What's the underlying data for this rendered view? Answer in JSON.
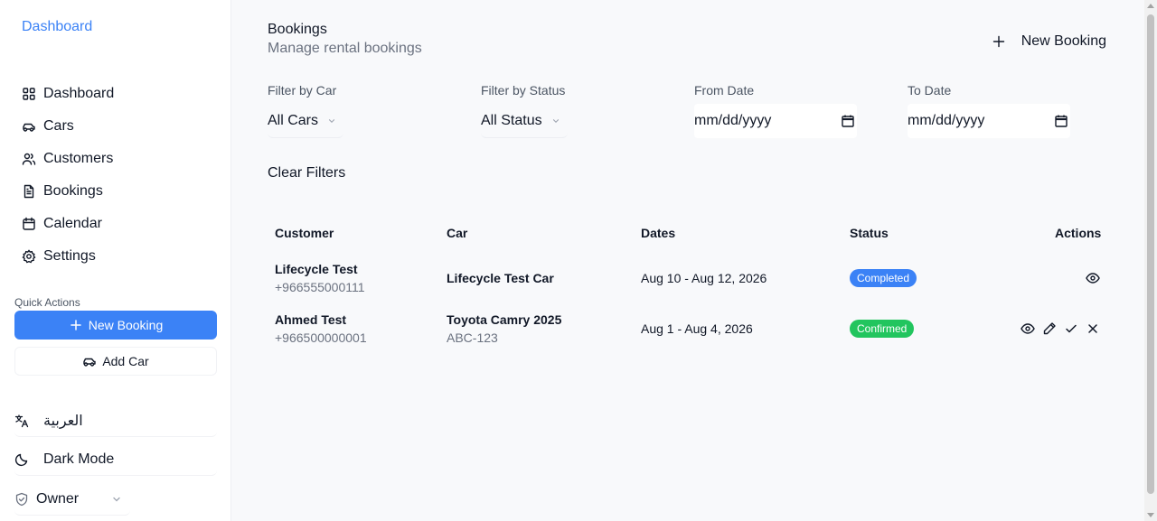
{
  "sidebar": {
    "brand": "Dashboard",
    "nav": [
      {
        "label": "Dashboard",
        "icon": "grid-icon"
      },
      {
        "label": "Cars",
        "icon": "car-icon"
      },
      {
        "label": "Customers",
        "icon": "users-icon"
      },
      {
        "label": "Bookings",
        "icon": "file-text-icon"
      },
      {
        "label": "Calendar",
        "icon": "calendar-icon"
      },
      {
        "label": "Settings",
        "icon": "gear-icon"
      }
    ],
    "quick_actions_label": "Quick Actions",
    "new_booking_label": "New Booking",
    "add_car_label": "Add Car",
    "language_label": "العربية",
    "dark_mode_label": "Dark Mode",
    "role_label": "Owner"
  },
  "header": {
    "title": "Bookings",
    "subtitle": "Manage rental bookings",
    "new_booking_label": "New Booking"
  },
  "filters": {
    "car": {
      "label": "Filter by Car",
      "value": "All Cars"
    },
    "status": {
      "label": "Filter by Status",
      "value": "All Status"
    },
    "from": {
      "label": "From Date",
      "placeholder": "mm/dd/yyyy"
    },
    "to": {
      "label": "To Date",
      "placeholder": "mm/dd/yyyy"
    },
    "clear_label": "Clear Filters"
  },
  "table": {
    "columns": [
      "Customer",
      "Car",
      "Dates",
      "Status",
      "Actions"
    ],
    "rows": [
      {
        "customer": "Lifecycle Test",
        "phone": "+966555000111",
        "car": "Lifecycle Test Car",
        "plate": "",
        "dates": "Aug 10 - Aug 12, 2026",
        "status": "Completed",
        "status_color": "#3b82f6",
        "actions": [
          "eye-icon"
        ]
      },
      {
        "customer": "Ahmed Test",
        "phone": "+966500000001",
        "car": "Toyota Camry 2025",
        "plate": "ABC-123",
        "dates": "Aug 1 - Aug 4, 2026",
        "status": "Confirmed",
        "status_color": "#22c55e",
        "actions": [
          "eye-icon",
          "pencil-icon",
          "check-icon",
          "x-icon"
        ]
      }
    ]
  },
  "colors": {
    "accent": "#3b82f6",
    "confirmed": "#22c55e"
  }
}
